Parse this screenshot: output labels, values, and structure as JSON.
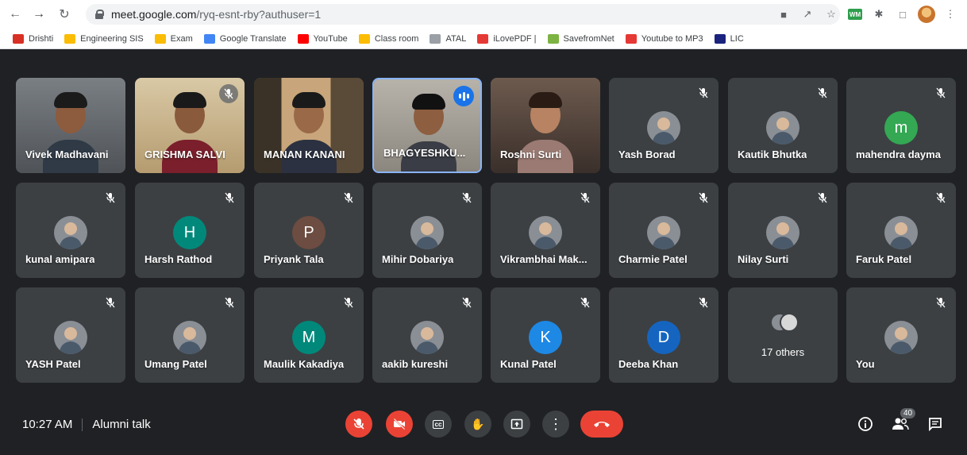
{
  "browser": {
    "url_host": "meet.google.com",
    "url_path": "/ryq-esnt-rby?authuser=1",
    "bookmarks": [
      {
        "label": "Drishti",
        "color": "#d93025"
      },
      {
        "label": "Engineering SIS",
        "color": "#fbbc04"
      },
      {
        "label": "Exam",
        "color": "#fbbc04"
      },
      {
        "label": "Google Translate",
        "color": "#4285f4"
      },
      {
        "label": "YouTube",
        "color": "#ff0000"
      },
      {
        "label": "Class room",
        "color": "#fbbc04"
      },
      {
        "label": "ATAL",
        "color": "#9aa0a6"
      },
      {
        "label": "iLovePDF |",
        "color": "#e53935"
      },
      {
        "label": "SavefromNet",
        "color": "#7cb342"
      },
      {
        "label": "Youtube to MP3",
        "color": "#e53935"
      },
      {
        "label": "LIC",
        "color": "#1a237e"
      }
    ]
  },
  "meeting": {
    "time": "10:27 AM",
    "title": "Alumni talk",
    "participant_count": "40",
    "accent": "#8ab4f8",
    "danger": "#ea4335"
  },
  "tiles": [
    {
      "name": "Vivek Madhavani",
      "kind": "video"
    },
    {
      "name": "GRISHMA SALVI",
      "kind": "video"
    },
    {
      "name": "MANAN KANANI",
      "kind": "video"
    },
    {
      "name": "BHAGYESHKU...",
      "kind": "video"
    },
    {
      "name": "Roshni Surti",
      "kind": "video"
    },
    {
      "name": "Yash Borad",
      "kind": "photo"
    },
    {
      "name": "Kautik Bhutka",
      "kind": "photo"
    },
    {
      "name": "mahendra dayma",
      "kind": "letter",
      "letter": "m",
      "color": "#34a853"
    },
    {
      "name": "kunal amipara",
      "kind": "photo"
    },
    {
      "name": "Harsh Rathod",
      "kind": "letter",
      "letter": "H",
      "color": "#00897b"
    },
    {
      "name": "Priyank Tala",
      "kind": "letter",
      "letter": "P",
      "color": "#6d4c41"
    },
    {
      "name": "Mihir Dobariya",
      "kind": "photo"
    },
    {
      "name": "Vikrambhai Mak...",
      "kind": "photo"
    },
    {
      "name": "Charmie Patel",
      "kind": "photo"
    },
    {
      "name": "Nilay Surti",
      "kind": "photo"
    },
    {
      "name": "Faruk Patel",
      "kind": "photo"
    },
    {
      "name": "YASH Patel",
      "kind": "photo"
    },
    {
      "name": "Umang Patel",
      "kind": "photo"
    },
    {
      "name": "Maulik Kakadiya",
      "kind": "letter",
      "letter": "M",
      "color": "#00897b"
    },
    {
      "name": "aakib kureshi",
      "kind": "photo"
    },
    {
      "name": "Kunal Patel",
      "kind": "letter",
      "letter": "K",
      "color": "#1e88e5"
    },
    {
      "name": "Deeba Khan",
      "kind": "letter",
      "letter": "D",
      "color": "#1565c0"
    },
    {
      "name": "17 others",
      "kind": "others"
    },
    {
      "name": "You",
      "kind": "photo"
    }
  ],
  "controls": {
    "mic": "mic-off-icon",
    "camera": "camera-off-icon",
    "captions_label": "cc",
    "hand": "raise-hand-icon",
    "present": "present-icon",
    "more": "more-options-icon",
    "leave": "leave-call-icon"
  }
}
